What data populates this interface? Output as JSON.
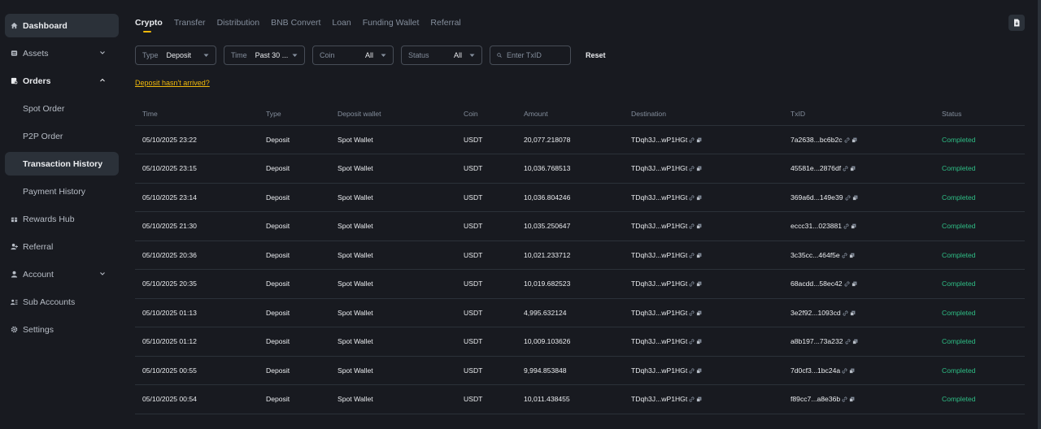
{
  "sidebar": {
    "items": [
      {
        "label": "Dashboard",
        "icon": "home-icon"
      },
      {
        "label": "Assets",
        "icon": "wallet-icon"
      },
      {
        "label": "Orders",
        "icon": "orders-icon"
      },
      {
        "label": "Spot Order"
      },
      {
        "label": "P2P Order"
      },
      {
        "label": "Transaction History"
      },
      {
        "label": "Payment History"
      },
      {
        "label": "Rewards Hub",
        "icon": "gift-icon"
      },
      {
        "label": "Referral",
        "icon": "referral-icon"
      },
      {
        "label": "Account",
        "icon": "user-icon"
      },
      {
        "label": "Sub Accounts",
        "icon": "sub-accounts-icon"
      },
      {
        "label": "Settings",
        "icon": "gear-icon"
      }
    ]
  },
  "tabs": [
    "Crypto",
    "Transfer",
    "Distribution",
    "BNB Convert",
    "Loan",
    "Funding Wallet",
    "Referral"
  ],
  "filters": {
    "type": {
      "label": "Type",
      "value": "Deposit"
    },
    "time": {
      "label": "Time",
      "value": "Past 30 ..."
    },
    "coin": {
      "label": "Coin",
      "value": "All"
    },
    "status": {
      "label": "Status",
      "value": "All"
    },
    "txid_placeholder": "Enter TxID",
    "reset": "Reset"
  },
  "notice": "Deposit hasn't arrived?",
  "table": {
    "headers": [
      "Time",
      "Type",
      "Deposit wallet",
      "Coin",
      "Amount",
      "Destination",
      "TxID",
      "Status"
    ],
    "rows": [
      [
        "05/10/2025 23:22",
        "Deposit",
        "Spot Wallet",
        "USDT",
        "20,077.218078",
        "TDqh3J...wP1HGt",
        "7a2638...bc6b2c",
        "Completed"
      ],
      [
        "05/10/2025 23:15",
        "Deposit",
        "Spot Wallet",
        "USDT",
        "10,036.768513",
        "TDqh3J...wP1HGt",
        "45581e...2876df",
        "Completed"
      ],
      [
        "05/10/2025 23:14",
        "Deposit",
        "Spot Wallet",
        "USDT",
        "10,036.804246",
        "TDqh3J...wP1HGt",
        "369a6d...149e39",
        "Completed"
      ],
      [
        "05/10/2025 21:30",
        "Deposit",
        "Spot Wallet",
        "USDT",
        "10,035.250647",
        "TDqh3J...wP1HGt",
        "eccc31...023881",
        "Completed"
      ],
      [
        "05/10/2025 20:36",
        "Deposit",
        "Spot Wallet",
        "USDT",
        "10,021.233712",
        "TDqh3J...wP1HGt",
        "3c35cc...464f5e",
        "Completed"
      ],
      [
        "05/10/2025 20:35",
        "Deposit",
        "Spot Wallet",
        "USDT",
        "10,019.682523",
        "TDqh3J...wP1HGt",
        "68acdd...58ec42",
        "Completed"
      ],
      [
        "05/10/2025 01:13",
        "Deposit",
        "Spot Wallet",
        "USDT",
        "4,995.632124",
        "TDqh3J...wP1HGt",
        "3e2f92...1093cd",
        "Completed"
      ],
      [
        "05/10/2025 01:12",
        "Deposit",
        "Spot Wallet",
        "USDT",
        "10,009.103626",
        "TDqh3J...wP1HGt",
        "a8b197...73a232",
        "Completed"
      ],
      [
        "05/10/2025 00:55",
        "Deposit",
        "Spot Wallet",
        "USDT",
        "9,994.853848",
        "TDqh3J...wP1HGt",
        "7d0cf3...1bc24a",
        "Completed"
      ],
      [
        "05/10/2025 00:54",
        "Deposit",
        "Spot Wallet",
        "USDT",
        "10,011.438455",
        "TDqh3J...wP1HGt",
        "f89cc7...a8e36b",
        "Completed"
      ]
    ]
  },
  "colors": {
    "accent": "#f0b90b",
    "success": "#2ebd85",
    "bg": "#181a20",
    "panel": "#2b3139"
  }
}
